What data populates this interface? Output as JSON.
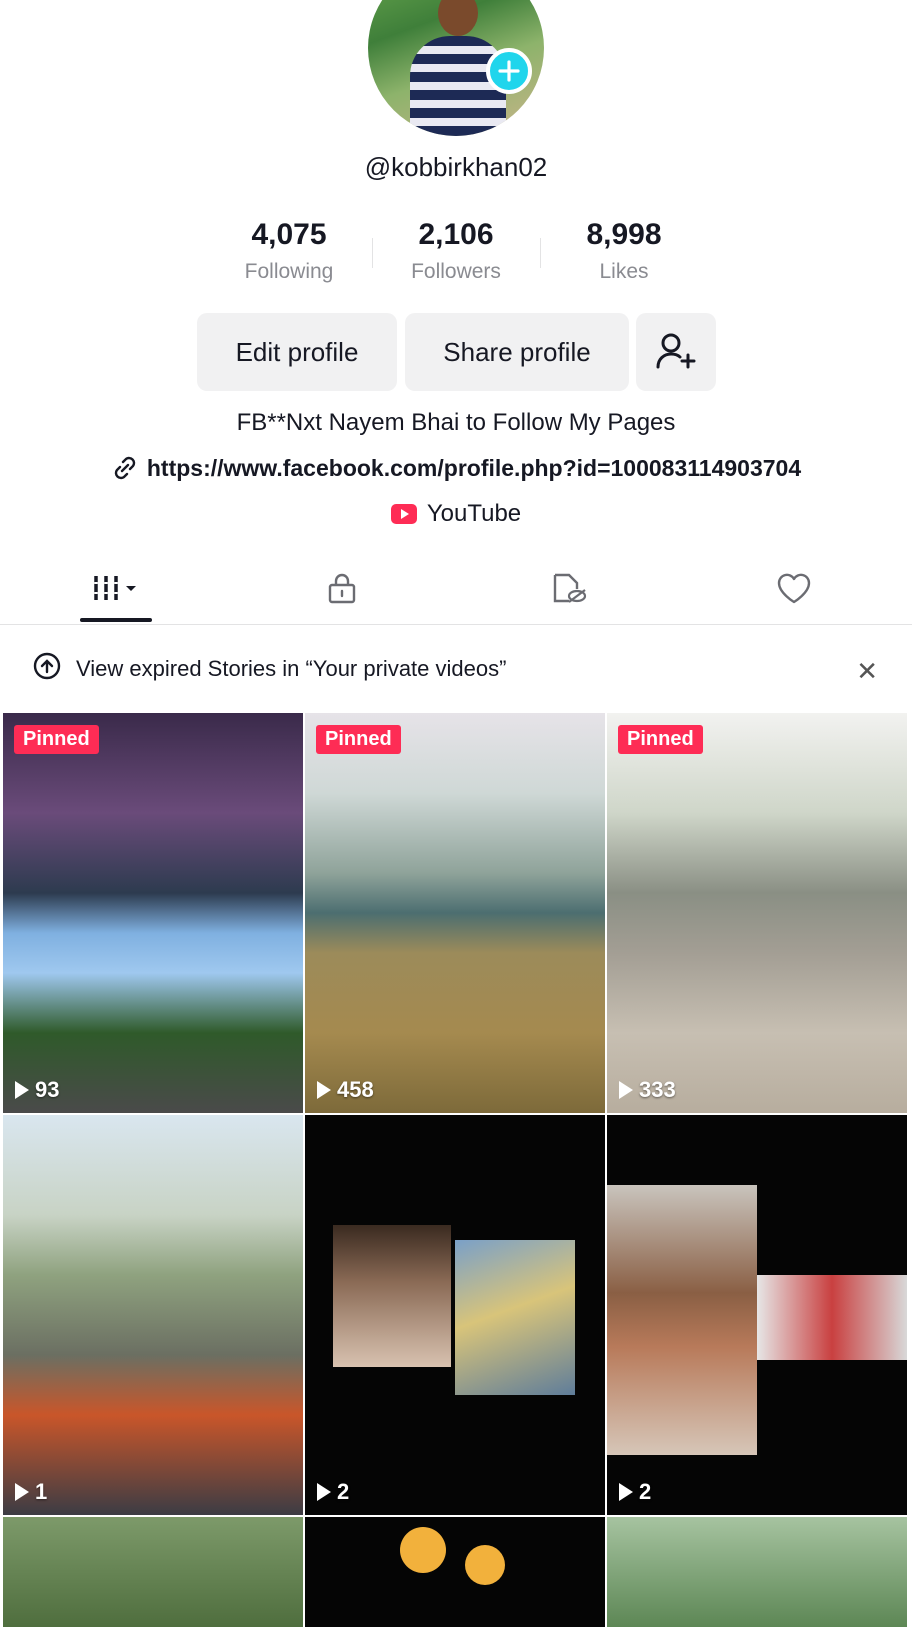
{
  "profile": {
    "username": "@kobbirkhan02",
    "bio": "FB**Nxt Nayem Bhai to Follow My Pages",
    "link": "https://www.facebook.com/profile.php?id=100083114903704",
    "youtube_label": "YouTube"
  },
  "stats": [
    {
      "value": "4,075",
      "label": "Following"
    },
    {
      "value": "2,106",
      "label": "Followers"
    },
    {
      "value": "8,998",
      "label": "Likes"
    }
  ],
  "buttons": {
    "edit": "Edit profile",
    "share": "Share profile"
  },
  "tabs": [
    {
      "icon": "grid-icon",
      "selected": true
    },
    {
      "icon": "lock-icon",
      "selected": false
    },
    {
      "icon": "hidden-video-icon",
      "selected": false
    },
    {
      "icon": "heart-icon",
      "selected": false
    }
  ],
  "notice": {
    "text": "View expired Stories in “Your private videos”"
  },
  "videos": [
    {
      "pinned": true,
      "pinned_label": "Pinned",
      "views": "93"
    },
    {
      "pinned": true,
      "pinned_label": "Pinned",
      "views": "458"
    },
    {
      "pinned": true,
      "pinned_label": "Pinned",
      "views": "333"
    },
    {
      "pinned": false,
      "views": "1"
    },
    {
      "pinned": false,
      "views": "2"
    },
    {
      "pinned": false,
      "views": "2"
    }
  ],
  "colors": {
    "accent": "#fe2c55",
    "plus_badge": "#20d5ec",
    "text": "#161823",
    "muted": "#8a8b91"
  }
}
